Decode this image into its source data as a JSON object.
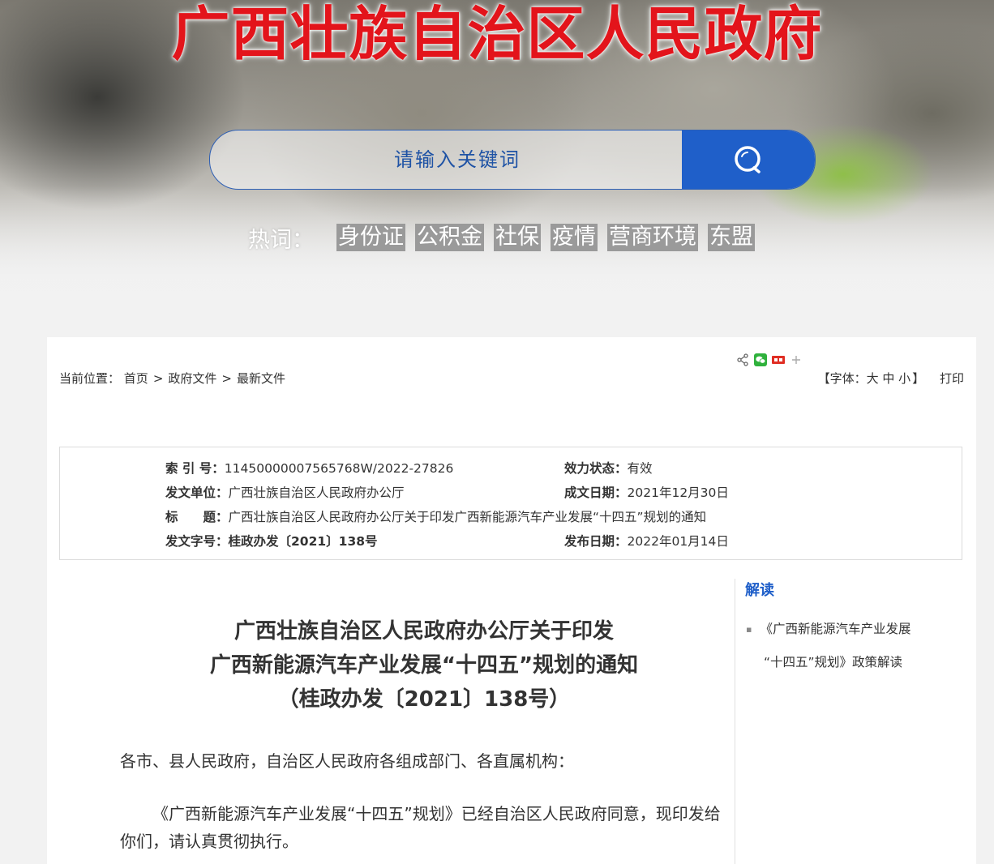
{
  "header": {
    "site_title": "广西壮族自治区人民政府",
    "search_placeholder": "请输入关键词",
    "search_icon": "search-icon",
    "hotwords_label": "热词：",
    "hotwords": [
      "身份证",
      "公积金",
      "社保",
      "疫情",
      "营商环境",
      "东盟"
    ]
  },
  "breadcrumb": {
    "label": "当前位置：",
    "items": [
      "首页",
      "政府文件",
      "最新文件"
    ],
    "separator": ">"
  },
  "share": {
    "icons": [
      "share-icon",
      "wechat-icon",
      "toutiao-icon",
      "plus-icon"
    ]
  },
  "tools": {
    "font_label_open": "【字体：",
    "font_large": "大",
    "font_medium": "中",
    "font_small": "小",
    "font_label_close": "】",
    "print": "打印"
  },
  "meta": {
    "index_key": "索 引 号：",
    "index_value": "11450000007565768W/2022-27826",
    "status_key": "效力状态：",
    "status_value": "有效",
    "issuer_key": "发文单位：",
    "issuer_value": "广西壮族自治区人民政府办公厅",
    "date_key": "成文日期：",
    "date_value": "2021年12月30日",
    "title_key": "标　　题：",
    "title_value": "广西壮族自治区人民政府办公厅关于印发广西新能源汽车产业发展“十四五”规划的通知",
    "docno_key": "发文字号：",
    "docno_value": "桂政办发〔2021〕138号",
    "publish_key": "发布日期：",
    "publish_value": "2022年01月14日"
  },
  "sidebar": {
    "title": "解读",
    "items": [
      {
        "line1": "《广西新能源汽车产业发展",
        "line2": "“十四五”规划》政策解读"
      }
    ]
  },
  "article": {
    "title_lines": [
      "广西壮族自治区人民政府办公厅关于印发",
      "广西新能源汽车产业发展“十四五”规划的通知",
      "（桂政办发〔2021〕138号）"
    ],
    "p1": "各市、县人民政府，自治区人民政府各组成部门、各直属机构：",
    "p2": "《广西新能源汽车产业发展“十四五”规划》已经自治区人民政府同意，现印发给你们，请认真贯彻执行。"
  },
  "colors": {
    "title_red": "#e3141b",
    "accent_blue": "#1f5fc9",
    "hotword_bg": "#9a9a9a"
  }
}
